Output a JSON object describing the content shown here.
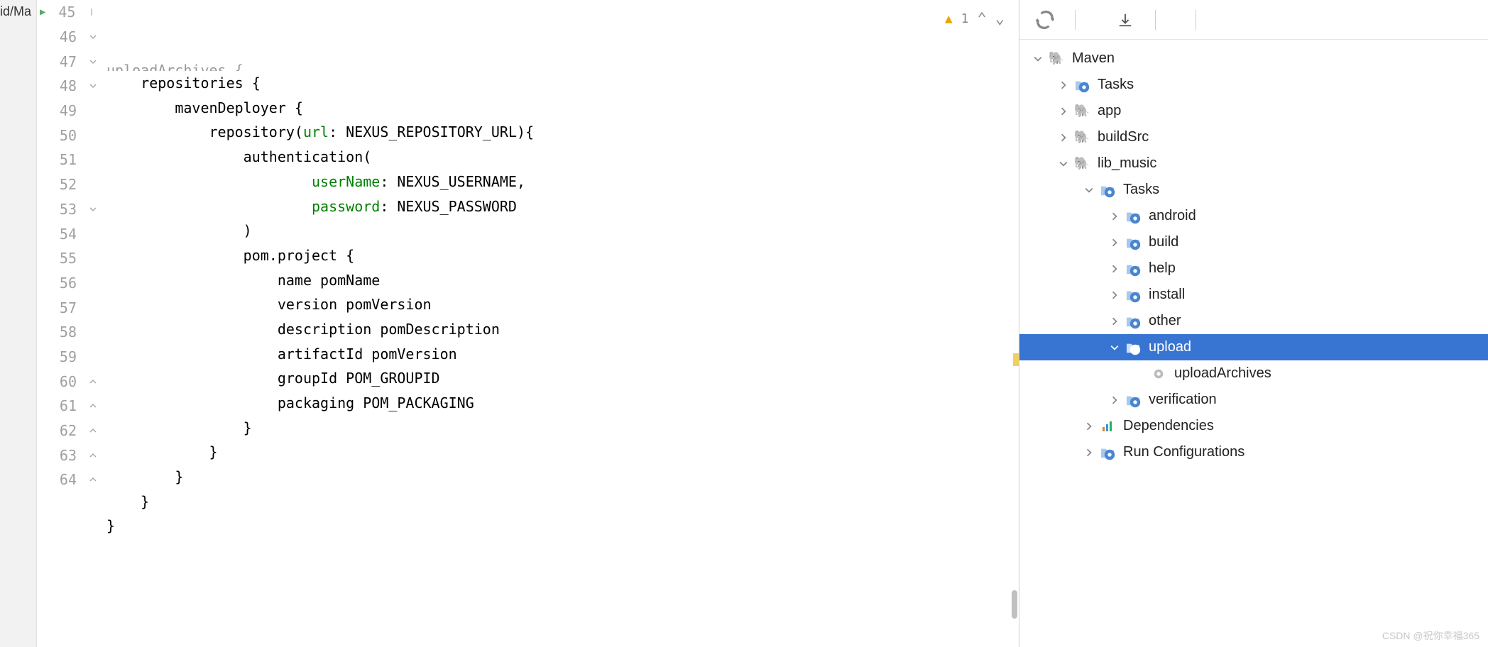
{
  "left_remnant": "id/Ma",
  "editor": {
    "hint_count": "1",
    "lines": [
      {
        "n": "45",
        "fold": "mid",
        "indent": 0,
        "tokens": [
          {
            "t": "plain",
            "v": "uploadArchives {"
          }
        ],
        "run": true,
        "cut": true
      },
      {
        "n": "46",
        "fold": "open",
        "indent": 1,
        "tokens": [
          {
            "t": "plain",
            "v": "repositories {"
          }
        ]
      },
      {
        "n": "47",
        "fold": "open",
        "indent": 2,
        "tokens": [
          {
            "t": "plain",
            "v": "mavenDeployer {"
          }
        ]
      },
      {
        "n": "48",
        "fold": "open",
        "indent": 3,
        "tokens": [
          {
            "t": "plain",
            "v": "repository("
          },
          {
            "t": "green",
            "v": "url"
          },
          {
            "t": "plain",
            "v": ": NEXUS_REPOSITORY_URL){"
          }
        ]
      },
      {
        "n": "49",
        "fold": "",
        "indent": 4,
        "tokens": [
          {
            "t": "plain",
            "v": "authentication("
          }
        ]
      },
      {
        "n": "50",
        "fold": "",
        "indent": 6,
        "tokens": [
          {
            "t": "green",
            "v": "userName"
          },
          {
            "t": "plain",
            "v": ": NEXUS_USERNAME,"
          }
        ]
      },
      {
        "n": "51",
        "fold": "",
        "indent": 6,
        "tokens": [
          {
            "t": "green",
            "v": "password"
          },
          {
            "t": "plain",
            "v": ": NEXUS_PASSWORD"
          }
        ]
      },
      {
        "n": "52",
        "fold": "",
        "indent": 4,
        "tokens": [
          {
            "t": "plain",
            "v": ")"
          }
        ]
      },
      {
        "n": "53",
        "fold": "open",
        "indent": 4,
        "tokens": [
          {
            "t": "plain",
            "v": "pom.project {"
          }
        ]
      },
      {
        "n": "54",
        "fold": "",
        "indent": 5,
        "tokens": [
          {
            "t": "plain",
            "v": "name pomName"
          }
        ]
      },
      {
        "n": "55",
        "fold": "",
        "indent": 5,
        "tokens": [
          {
            "t": "plain",
            "v": "version pomVersion"
          }
        ]
      },
      {
        "n": "56",
        "fold": "",
        "indent": 5,
        "tokens": [
          {
            "t": "plain",
            "v": "description pomDescription"
          }
        ]
      },
      {
        "n": "57",
        "fold": "",
        "indent": 5,
        "tokens": [
          {
            "t": "plain",
            "v": "artifactId pomVersion"
          }
        ]
      },
      {
        "n": "58",
        "fold": "",
        "indent": 5,
        "tokens": [
          {
            "t": "plain",
            "v": "groupId POM_GROUPID"
          }
        ]
      },
      {
        "n": "59",
        "fold": "",
        "indent": 5,
        "tokens": [
          {
            "t": "plain",
            "v": "packaging POM_PACKAGING"
          }
        ]
      },
      {
        "n": "60",
        "fold": "close",
        "indent": 4,
        "tokens": [
          {
            "t": "plain",
            "v": "}"
          }
        ]
      },
      {
        "n": "61",
        "fold": "close",
        "indent": 3,
        "tokens": [
          {
            "t": "plain",
            "v": "}"
          }
        ]
      },
      {
        "n": "62",
        "fold": "close",
        "indent": 2,
        "tokens": [
          {
            "t": "plain",
            "v": "}"
          }
        ]
      },
      {
        "n": "63",
        "fold": "close",
        "indent": 1,
        "tokens": [
          {
            "t": "plain",
            "v": "}"
          }
        ]
      },
      {
        "n": "64",
        "fold": "close",
        "indent": 0,
        "tokens": [
          {
            "t": "plain",
            "v": "}"
          }
        ],
        "selectedGutter": true
      }
    ]
  },
  "tree": {
    "nodes": [
      {
        "depth": 0,
        "chev": "down",
        "icon": "elephant",
        "label": "Maven"
      },
      {
        "depth": 1,
        "chev": "right",
        "icon": "folder-gear",
        "label": "Tasks"
      },
      {
        "depth": 1,
        "chev": "right",
        "icon": "elephant",
        "label": "app"
      },
      {
        "depth": 1,
        "chev": "right",
        "icon": "elephant",
        "label": "buildSrc"
      },
      {
        "depth": 1,
        "chev": "down",
        "icon": "elephant",
        "label": "lib_music"
      },
      {
        "depth": 2,
        "chev": "down",
        "icon": "folder-gear",
        "label": "Tasks"
      },
      {
        "depth": 3,
        "chev": "right",
        "icon": "folder-gear",
        "label": "android"
      },
      {
        "depth": 3,
        "chev": "right",
        "icon": "folder-gear",
        "label": "build"
      },
      {
        "depth": 3,
        "chev": "right",
        "icon": "folder-gear",
        "label": "help"
      },
      {
        "depth": 3,
        "chev": "right",
        "icon": "folder-gear",
        "label": "install"
      },
      {
        "depth": 3,
        "chev": "right",
        "icon": "folder-gear",
        "label": "other"
      },
      {
        "depth": 3,
        "chev": "down",
        "icon": "folder-gear",
        "label": "upload",
        "selected": true
      },
      {
        "depth": 4,
        "chev": "",
        "icon": "gear",
        "label": "uploadArchives"
      },
      {
        "depth": 3,
        "chev": "right",
        "icon": "folder-gear",
        "label": "verification"
      },
      {
        "depth": 2,
        "chev": "right",
        "icon": "bars",
        "label": "Dependencies"
      },
      {
        "depth": 2,
        "chev": "right",
        "icon": "folder-gear",
        "label": "Run Configurations"
      }
    ]
  },
  "watermark": "CSDN @祝你幸福365"
}
